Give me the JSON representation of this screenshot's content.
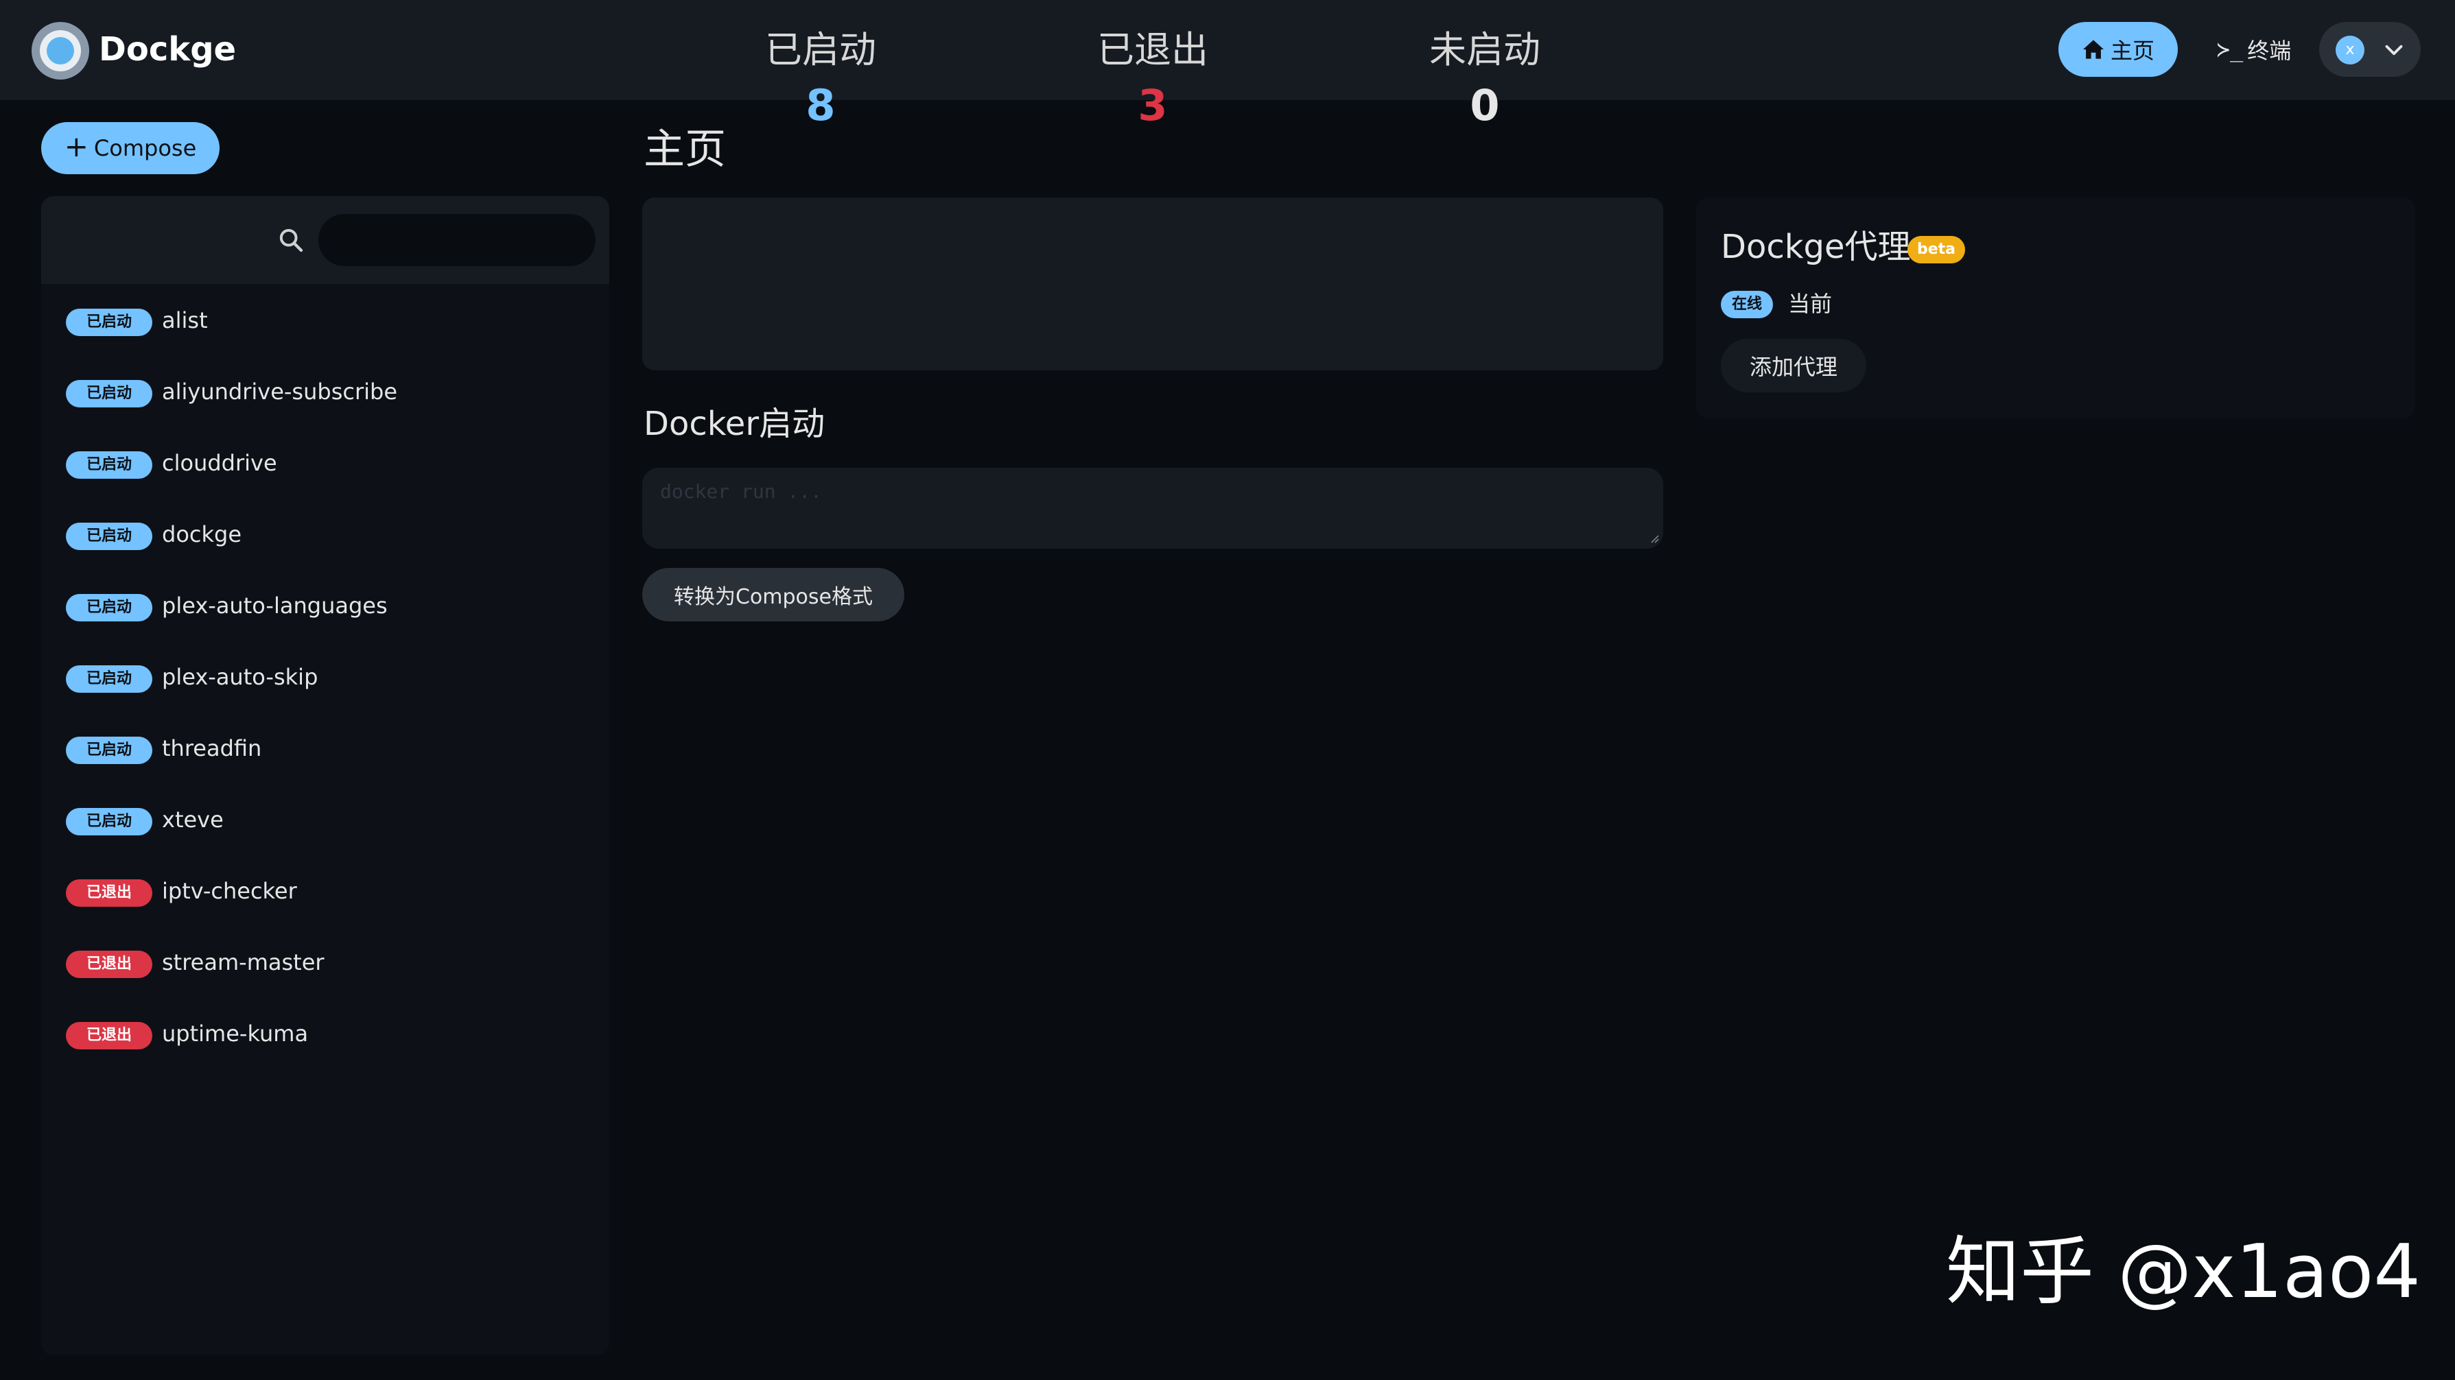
{
  "header": {
    "brand": "Dockge",
    "nav_home_label": "主页",
    "nav_terminal_prompt": "≻_",
    "nav_terminal_label": "终端",
    "avatar_initial": "x",
    "icons": [
      "dockge-logo",
      "home-icon",
      "terminal-icon",
      "chevron-down-icon"
    ]
  },
  "sidebar": {
    "compose_label": "Compose",
    "search": {
      "placeholder": "",
      "value": ""
    },
    "stacks": [
      {
        "status": "已启动",
        "state": "running",
        "name": "alist"
      },
      {
        "status": "已启动",
        "state": "running",
        "name": "aliyundrive-subscribe"
      },
      {
        "status": "已启动",
        "state": "running",
        "name": "clouddrive"
      },
      {
        "status": "已启动",
        "state": "running",
        "name": "dockge"
      },
      {
        "status": "已启动",
        "state": "running",
        "name": "plex-auto-languages"
      },
      {
        "status": "已启动",
        "state": "running",
        "name": "plex-auto-skip"
      },
      {
        "status": "已启动",
        "state": "running",
        "name": "threadfin"
      },
      {
        "status": "已启动",
        "state": "running",
        "name": "xteve"
      },
      {
        "status": "已退出",
        "state": "exited",
        "name": "iptv-checker"
      },
      {
        "status": "已退出",
        "state": "exited",
        "name": "stream-master"
      },
      {
        "status": "已退出",
        "state": "exited",
        "name": "uptime-kuma"
      }
    ]
  },
  "main": {
    "title": "主页",
    "stats": {
      "active_label": "已启动",
      "active_value": "8",
      "exited_label": "已退出",
      "exited_value": "3",
      "inactive_label": "未启动",
      "inactive_value": "0"
    },
    "docker_run": {
      "title": "Docker启动",
      "placeholder": "docker run ...",
      "convert_label": "转换为Compose格式"
    }
  },
  "agents": {
    "title": "Dockge代理",
    "beta_label": "beta",
    "online_label": "在线",
    "current_label": "当前",
    "add_label": "添加代理"
  },
  "watermark": "知乎 @x1ao4",
  "colors": {
    "accent": "#74c2ff",
    "running": "#74c2ff",
    "exited": "#dc3545",
    "beta": "#f0ad14",
    "background": "#090c10",
    "card": "#161b22"
  }
}
